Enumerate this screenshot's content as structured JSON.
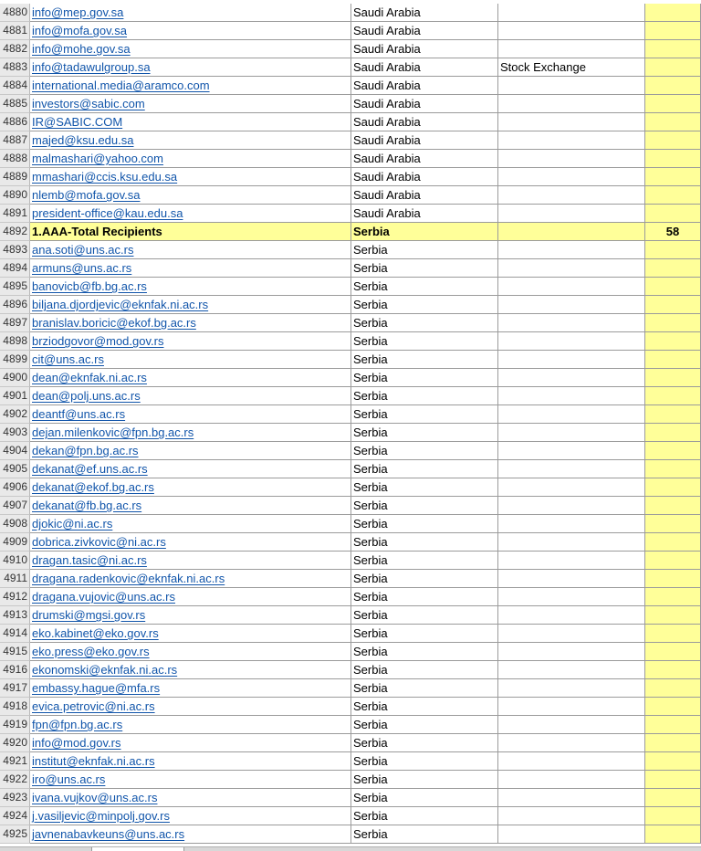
{
  "rows": [
    {
      "num": "4880",
      "email": "info@mep.gov.sa",
      "country": "Saudi Arabia",
      "org": "",
      "count": ""
    },
    {
      "num": "4881",
      "email": "info@mofa.gov.sa",
      "country": "Saudi Arabia",
      "org": "",
      "count": ""
    },
    {
      "num": "4882",
      "email": "info@mohe.gov.sa",
      "country": "Saudi Arabia",
      "org": "",
      "count": ""
    },
    {
      "num": "4883",
      "email": "info@tadawulgroup.sa",
      "country": "Saudi Arabia",
      "org": "Stock Exchange",
      "count": ""
    },
    {
      "num": "4884",
      "email": "international.media@aramco.com",
      "country": "Saudi Arabia",
      "org": "",
      "count": ""
    },
    {
      "num": "4885",
      "email": "investors@sabic.com",
      "country": "Saudi Arabia",
      "org": "",
      "count": ""
    },
    {
      "num": "4886",
      "email": "IR@SABIC.COM",
      "country": "Saudi Arabia",
      "org": "",
      "count": ""
    },
    {
      "num": "4887",
      "email": "majed@ksu.edu.sa",
      "country": "Saudi Arabia",
      "org": "",
      "count": ""
    },
    {
      "num": "4888",
      "email": "malmashari@yahoo.com",
      "country": "Saudi Arabia",
      "org": "",
      "count": ""
    },
    {
      "num": "4889",
      "email": "mmashari@ccis.ksu.edu.sa",
      "country": "Saudi Arabia",
      "org": "",
      "count": ""
    },
    {
      "num": "4890",
      "email": "nlemb@mofa.gov.sa",
      "country": "Saudi Arabia",
      "org": "",
      "count": ""
    },
    {
      "num": "4891",
      "email": "president-office@kau.edu.sa",
      "country": "Saudi Arabia",
      "org": "",
      "count": ""
    },
    {
      "num": "4892",
      "email": "1.AAA-Total Recipients",
      "country": "Serbia",
      "org": "",
      "count": "58",
      "total": true
    },
    {
      "num": "4893",
      "email": "ana.soti@uns.ac.rs",
      "country": "Serbia",
      "org": "",
      "count": ""
    },
    {
      "num": "4894",
      "email": "armuns@uns.ac.rs",
      "country": "Serbia",
      "org": "",
      "count": ""
    },
    {
      "num": "4895",
      "email": "banovicb@fb.bg.ac.rs",
      "country": "Serbia",
      "org": "",
      "count": ""
    },
    {
      "num": "4896",
      "email": "biljana.djordjevic@eknfak.ni.ac.rs",
      "country": "Serbia",
      "org": "",
      "count": ""
    },
    {
      "num": "4897",
      "email": "branislav.boricic@ekof.bg.ac.rs",
      "country": "Serbia",
      "org": "",
      "count": ""
    },
    {
      "num": "4898",
      "email": "brziodgovor@mod.gov.rs",
      "country": "Serbia",
      "org": "",
      "count": ""
    },
    {
      "num": "4899",
      "email": "cit@uns.ac.rs",
      "country": "Serbia",
      "org": "",
      "count": ""
    },
    {
      "num": "4900",
      "email": "dean@eknfak.ni.ac.rs",
      "country": "Serbia",
      "org": "",
      "count": ""
    },
    {
      "num": "4901",
      "email": "dean@polj.uns.ac.rs",
      "country": "Serbia",
      "org": "",
      "count": ""
    },
    {
      "num": "4902",
      "email": "deantf@uns.ac.rs",
      "country": "Serbia",
      "org": "",
      "count": ""
    },
    {
      "num": "4903",
      "email": "dejan.milenkovic@fpn.bg.ac.rs",
      "country": "Serbia",
      "org": "",
      "count": ""
    },
    {
      "num": "4904",
      "email": "dekan@fpn.bg.ac.rs",
      "country": "Serbia",
      "org": "",
      "count": ""
    },
    {
      "num": "4905",
      "email": "dekanat@ef.uns.ac.rs",
      "country": "Serbia",
      "org": "",
      "count": ""
    },
    {
      "num": "4906",
      "email": "dekanat@ekof.bg.ac.rs",
      "country": "Serbia",
      "org": "",
      "count": ""
    },
    {
      "num": "4907",
      "email": "dekanat@fb.bg.ac.rs",
      "country": "Serbia",
      "org": "",
      "count": ""
    },
    {
      "num": "4908",
      "email": "djokic@ni.ac.rs",
      "country": "Serbia",
      "org": "",
      "count": ""
    },
    {
      "num": "4909",
      "email": "dobrica.zivkovic@ni.ac.rs",
      "country": "Serbia",
      "org": "",
      "count": ""
    },
    {
      "num": "4910",
      "email": "dragan.tasic@ni.ac.rs",
      "country": "Serbia",
      "org": "",
      "count": ""
    },
    {
      "num": "4911",
      "email": "dragana.radenkovic@eknfak.ni.ac.rs",
      "country": "Serbia",
      "org": "",
      "count": ""
    },
    {
      "num": "4912",
      "email": "dragana.vujovic@uns.ac.rs",
      "country": "Serbia",
      "org": "",
      "count": ""
    },
    {
      "num": "4913",
      "email": "drumski@mgsi.gov.rs",
      "country": "Serbia",
      "org": "",
      "count": ""
    },
    {
      "num": "4914",
      "email": "eko.kabinet@eko.gov.rs",
      "country": "Serbia",
      "org": "",
      "count": ""
    },
    {
      "num": "4915",
      "email": "eko.press@eko.gov.rs",
      "country": "Serbia",
      "org": "",
      "count": ""
    },
    {
      "num": "4916",
      "email": "ekonomski@eknfak.ni.ac.rs",
      "country": "Serbia",
      "org": "",
      "count": ""
    },
    {
      "num": "4917",
      "email": "embassy.hague@mfa.rs",
      "country": "Serbia",
      "org": "",
      "count": ""
    },
    {
      "num": "4918",
      "email": "evica.petrovic@ni.ac.rs",
      "country": "Serbia",
      "org": "",
      "count": ""
    },
    {
      "num": "4919",
      "email": "fpn@fpn.bg.ac.rs",
      "country": "Serbia",
      "org": "",
      "count": ""
    },
    {
      "num": "4920",
      "email": "info@mod.gov.rs",
      "country": "Serbia",
      "org": "",
      "count": ""
    },
    {
      "num": "4921",
      "email": "institut@eknfak.ni.ac.rs",
      "country": "Serbia",
      "org": "",
      "count": ""
    },
    {
      "num": "4922",
      "email": "iro@uns.ac.rs",
      "country": "Serbia",
      "org": "",
      "count": ""
    },
    {
      "num": "4923",
      "email": "ivana.vujkov@uns.ac.rs",
      "country": "Serbia",
      "org": "",
      "count": ""
    },
    {
      "num": "4924",
      "email": "j.vasiljevic@minpolj.gov.rs",
      "country": "Serbia",
      "org": "",
      "count": ""
    },
    {
      "num": "4925",
      "email": "javnenabavkeuns@uns.ac.rs",
      "country": "Serbia",
      "org": "",
      "count": ""
    }
  ],
  "colors": {
    "highlight": "#ffff99",
    "link": "#1155aa",
    "gridline": "#9b9b9b",
    "row_header_bg": "#e9e9e9"
  }
}
